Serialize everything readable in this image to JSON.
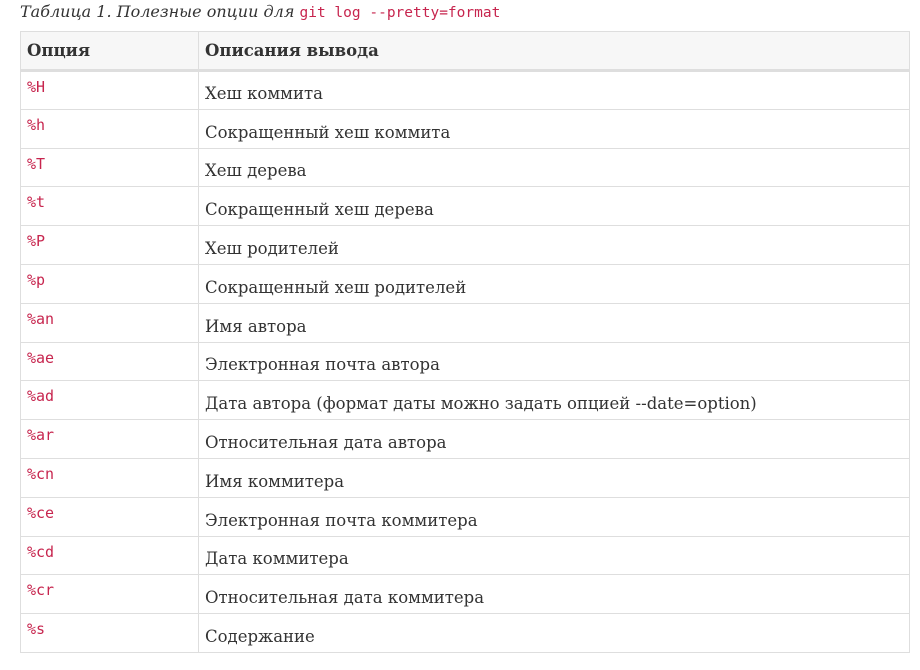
{
  "caption": {
    "label": "Таблица 1. Полезные опции для ",
    "code": "git log --pretty=format"
  },
  "table": {
    "headers": [
      "Опция",
      "Описания вывода"
    ],
    "rows": [
      {
        "option": "%H",
        "description": "Хеш коммита"
      },
      {
        "option": "%h",
        "description": "Сокращенный хеш коммита"
      },
      {
        "option": "%T",
        "description": "Хеш дерева"
      },
      {
        "option": "%t",
        "description": "Сокращенный хеш дерева"
      },
      {
        "option": "%P",
        "description": "Хеш родителей"
      },
      {
        "option": "%p",
        "description": "Сокращенный хеш родителей"
      },
      {
        "option": "%an",
        "description": "Имя автора"
      },
      {
        "option": "%ae",
        "description": "Электронная почта автора"
      },
      {
        "option": "%ad",
        "description": "Дата автора (формат даты можно задать опцией --date=option)"
      },
      {
        "option": "%ar",
        "description": "Относительная дата автора"
      },
      {
        "option": "%cn",
        "description": "Имя коммитера"
      },
      {
        "option": "%ce",
        "description": "Электронная почта коммитера"
      },
      {
        "option": "%cd",
        "description": "Дата коммитера"
      },
      {
        "option": "%cr",
        "description": "Относительная дата коммитера"
      },
      {
        "option": "%s",
        "description": "Содержание"
      }
    ]
  },
  "colors": {
    "code": "#c7254e",
    "text": "#333333",
    "border": "#dedede",
    "header_bg": "#f7f7f7"
  }
}
